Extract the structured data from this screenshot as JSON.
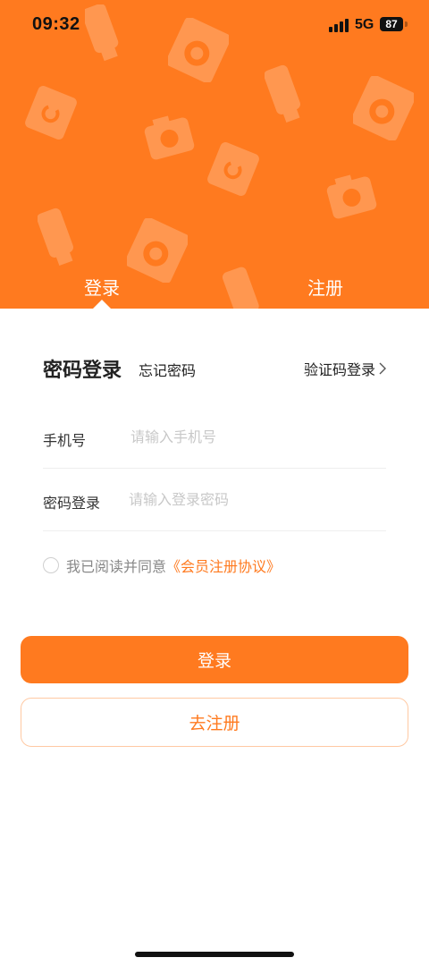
{
  "status_bar": {
    "time": "09:32",
    "network": "5G",
    "battery": "87"
  },
  "tabs": {
    "login": "登录",
    "register": "注册"
  },
  "form": {
    "title": "密码登录",
    "forgot_password": "忘记密码",
    "sms_login": "验证码登录",
    "phone_label": "手机号",
    "phone_placeholder": "请输入手机号",
    "password_label": "密码登录",
    "password_placeholder": "请输入登录密码",
    "agree_text": "我已阅读并同意",
    "agreement_link": "《会员注册协议》"
  },
  "buttons": {
    "login": "登录",
    "go_register": "去注册"
  },
  "colors": {
    "brand": "#ff7a1f",
    "text": "#222222",
    "placeholder": "#c8c8c8"
  },
  "icons": [
    "signal-icon",
    "battery-icon",
    "chevron-right-icon",
    "checkbox-icon"
  ]
}
